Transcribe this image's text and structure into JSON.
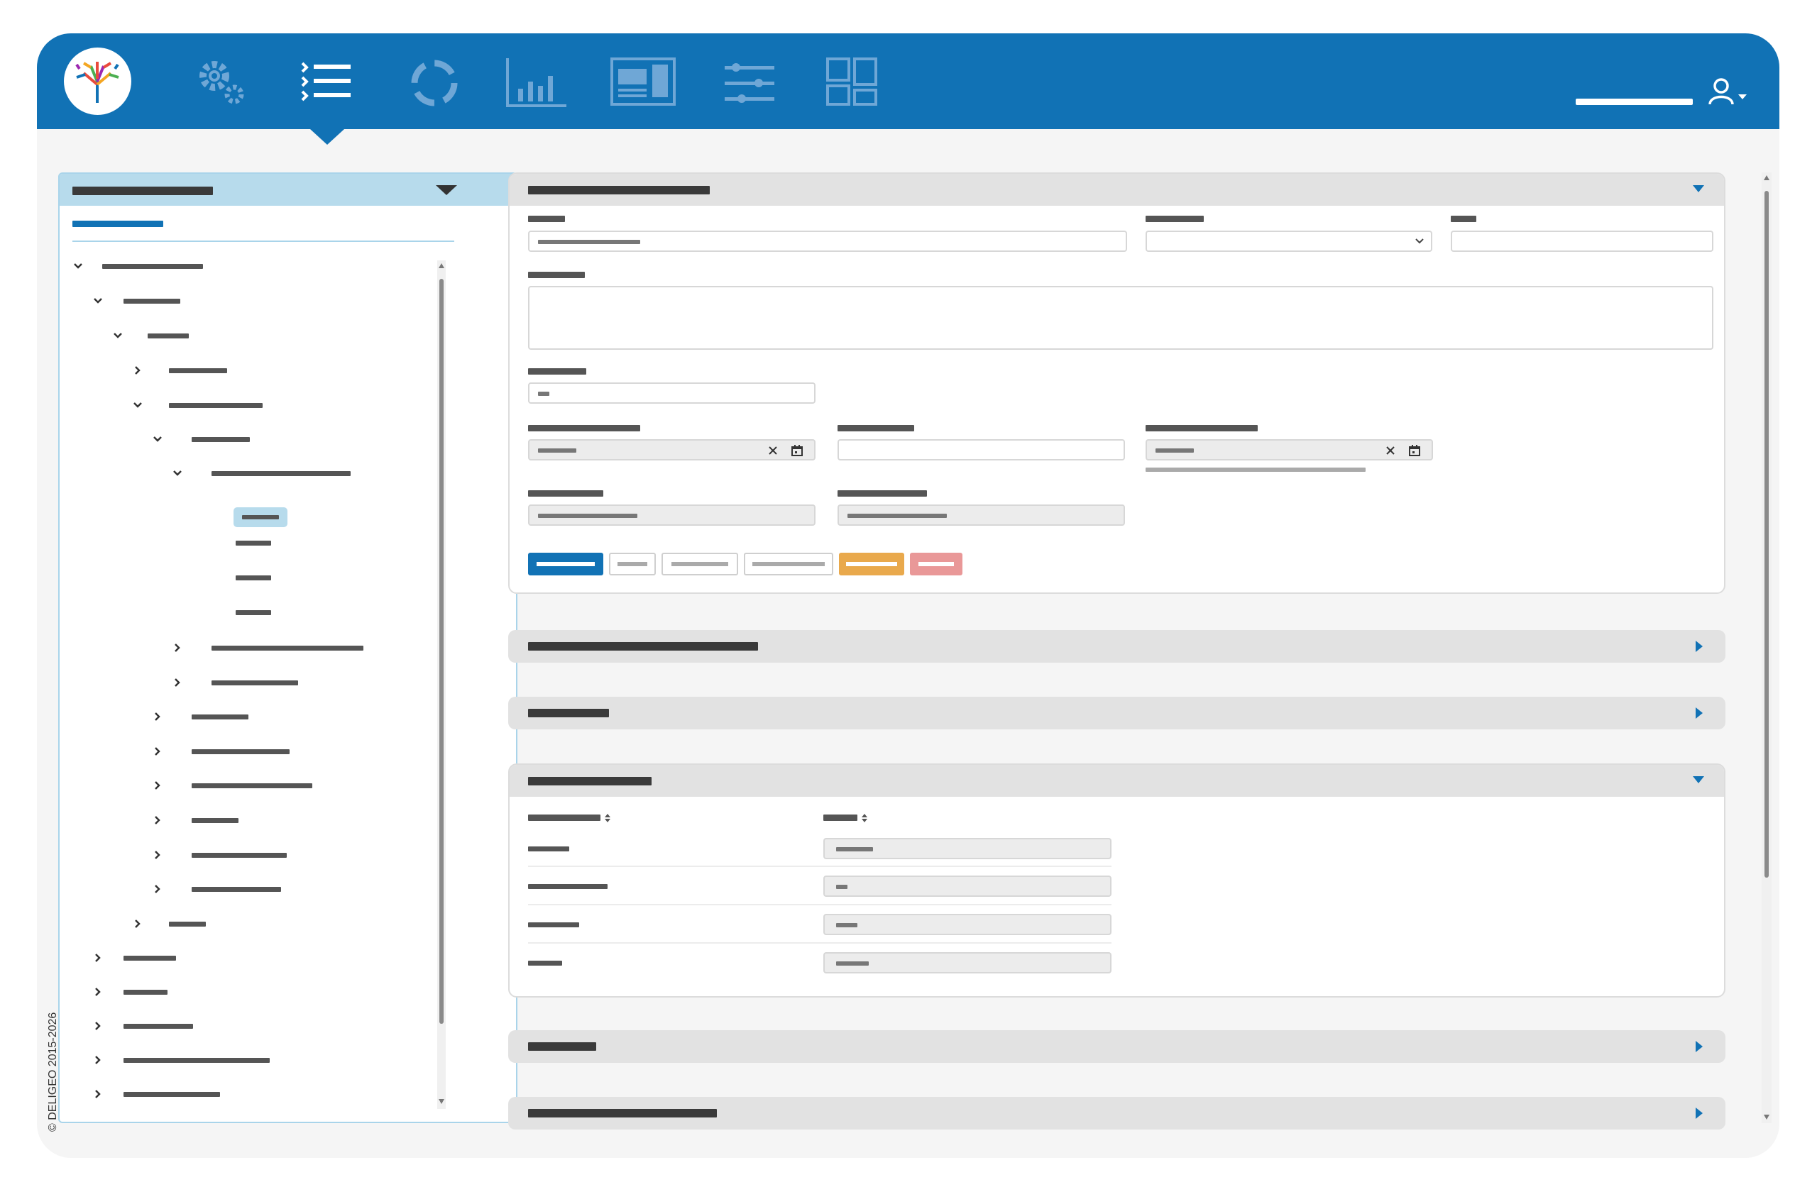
{
  "copyright": "© DELIGEO 2015-2026",
  "nav": {
    "items": [
      {
        "icon": "gears-icon"
      },
      {
        "icon": "list-icon",
        "active": true
      },
      {
        "icon": "refresh-icon"
      },
      {
        "icon": "bar-chart-icon"
      },
      {
        "icon": "dashboard-icon"
      },
      {
        "icon": "sliders-icon"
      },
      {
        "icon": "layout-grid-icon"
      }
    ],
    "user_icon": "user-icon"
  },
  "colors": {
    "brand": "#1172b5",
    "orange": "#e9a94c",
    "red": "#e99898",
    "panel_head": "#b7dbec"
  },
  "sections": [
    {
      "state": "expanded"
    },
    {
      "state": "collapsed"
    },
    {
      "state": "collapsed"
    },
    {
      "state": "expanded"
    },
    {
      "state": "collapsed"
    },
    {
      "state": "collapsed"
    }
  ]
}
